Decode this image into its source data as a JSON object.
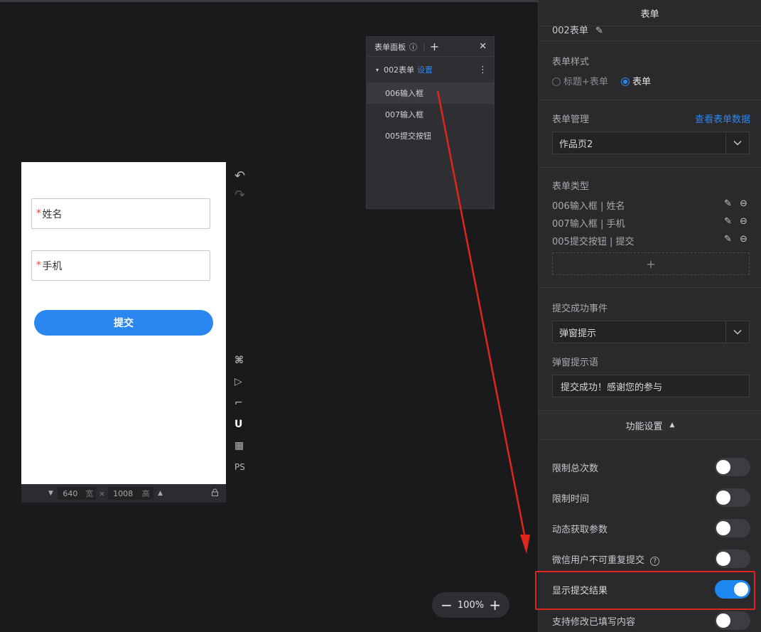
{
  "canvas": {
    "fields": [
      {
        "required_mark": "*",
        "label": "姓名"
      },
      {
        "required_mark": "*",
        "label": "手机"
      }
    ],
    "submit_label": "提交",
    "width": "640",
    "width_unit": "宽",
    "height": "1008",
    "height_unit": "高",
    "times": "×"
  },
  "side_tools": {
    "undo": "↶",
    "redo": "↷",
    "cmd": "⌘",
    "play": "▷",
    "ruler": "⌐",
    "magnet": "U",
    "grid": "▦",
    "ps": "PS"
  },
  "form_panel": {
    "title": "表单面板",
    "info": "ⓘ",
    "add": "+",
    "close": "✕",
    "root": {
      "caret": "▾",
      "name": "002表单",
      "settings": "设置",
      "more": "⋮"
    },
    "children": [
      "006输入框",
      "007输入框",
      "005提交按钮"
    ]
  },
  "zoom": {
    "minus": "−",
    "value": "100%",
    "plus": "+"
  },
  "right_panel": {
    "title": "表单",
    "form_name": "002表单",
    "style": {
      "label": "表单样式",
      "options": [
        "标题+表单",
        "表单"
      ],
      "selected": "表单"
    },
    "management": {
      "label": "表单管理",
      "link": "查看表单数据",
      "select_value": "作品页2"
    },
    "types": {
      "label": "表单类型",
      "items": [
        "006输入框 | 姓名",
        "007输入框 | 手机",
        "005提交按钮 | 提交"
      ],
      "add": "+"
    },
    "success_event": {
      "label": "提交成功事件",
      "select_value": "弹窗提示",
      "popup_label": "弹窗提示语",
      "popup_text": "提交成功！感谢您的参与"
    },
    "features": {
      "header": "功能设置",
      "collapse_icon": "▲",
      "toggles": [
        {
          "label": "限制总次数",
          "on": false
        },
        {
          "label": "限制时间",
          "on": false
        },
        {
          "label": "动态获取参数",
          "on": false
        },
        {
          "label": "微信用户不可重复提交",
          "on": false,
          "help": "?"
        },
        {
          "label": "显示提交结果",
          "on": true
        },
        {
          "label": "支持修改已填写内容",
          "on": false
        }
      ]
    }
  },
  "colors": {
    "accent": "#2b87f0",
    "highlight": "#e0261c",
    "toggle_on": "#1e88f0"
  }
}
